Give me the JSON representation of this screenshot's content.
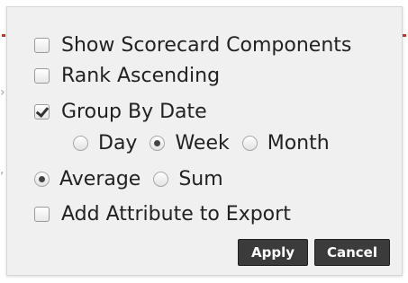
{
  "options": {
    "show_scorecard_components": {
      "label": "Show Scorecard Components",
      "checked": false
    },
    "rank_ascending": {
      "label": "Rank Ascending",
      "checked": false
    },
    "group_by_date": {
      "label": "Group By Date",
      "checked": true
    },
    "date_granularity": {
      "choices": [
        "Day",
        "Week",
        "Month"
      ],
      "selected": "Week"
    },
    "aggregation": {
      "choices": [
        "Average",
        "Sum"
      ],
      "selected": "Average"
    },
    "add_attribute_to_export": {
      "label": "Add Attribute to Export",
      "checked": false
    }
  },
  "buttons": {
    "apply_label": "Apply",
    "cancel_label": "Cancel"
  },
  "colors": {
    "popup_background": "#f0f0f0",
    "button_background": "#3b3b3b",
    "button_text": "#ffffff"
  }
}
